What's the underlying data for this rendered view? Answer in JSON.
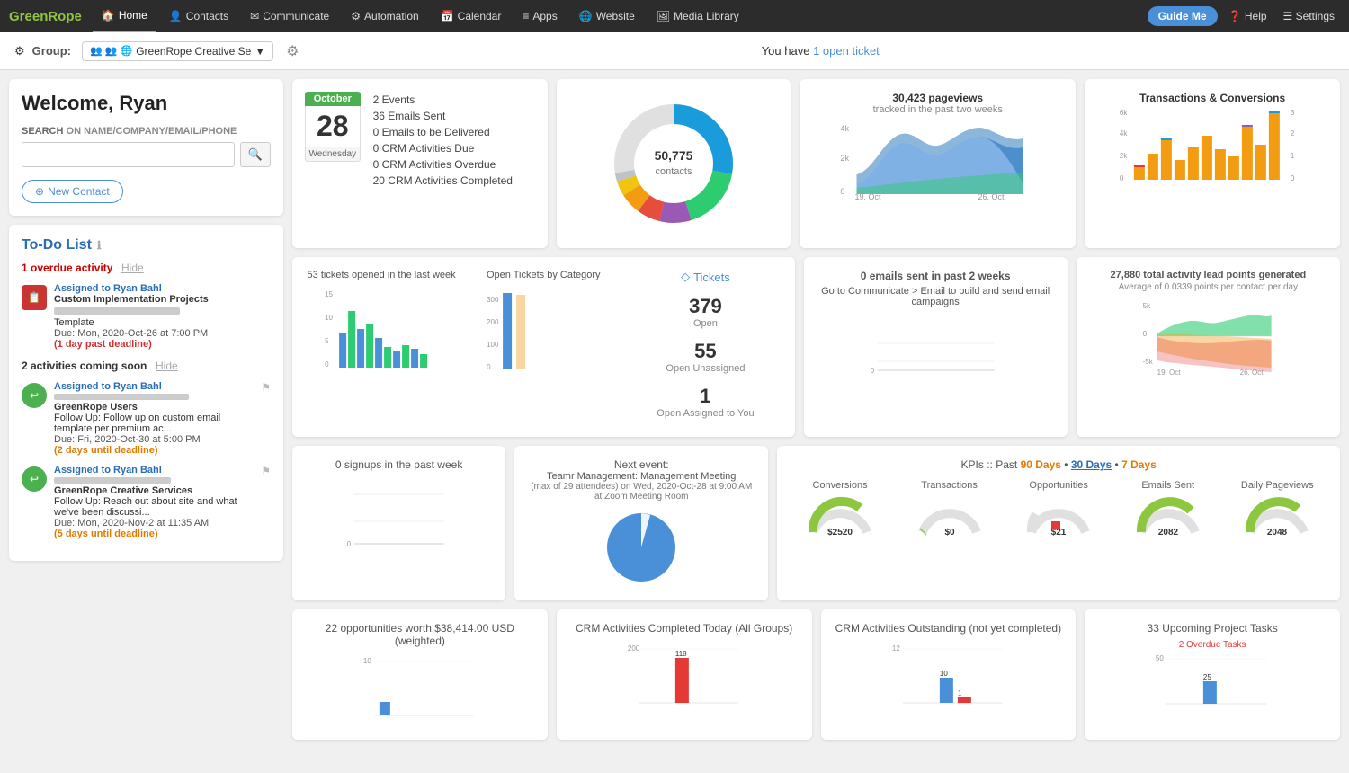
{
  "nav": {
    "logo_green": "GreenRope",
    "items": [
      {
        "label": "Home",
        "icon": "🏠",
        "active": true
      },
      {
        "label": "Contacts",
        "icon": "👤"
      },
      {
        "label": "Communicate",
        "icon": "✉"
      },
      {
        "label": "Automation",
        "icon": "⚙"
      },
      {
        "label": "Calendar",
        "icon": "📅"
      },
      {
        "label": "Apps",
        "icon": "≡"
      },
      {
        "label": "Website",
        "icon": "🌐"
      },
      {
        "label": "Media Library",
        "icon": "🖼"
      }
    ],
    "guide_me": "Guide Me",
    "help": "Help",
    "settings": "Settings"
  },
  "subbar": {
    "group_label": "Group:",
    "group_name": "GreenRope Creative Se",
    "open_ticket_text": "You have",
    "open_ticket_count": "1 open ticket"
  },
  "welcome": {
    "title": "Welcome, Ryan",
    "search_label": "SEARCH",
    "search_sublabel": "On Name/Company/Email/Phone",
    "new_contact": "New Contact"
  },
  "calendar_stats": {
    "month": "October",
    "day": "28",
    "weekday": "Wednesday",
    "stats": [
      {
        "label": "2 Events"
      },
      {
        "label": "36 Emails Sent"
      },
      {
        "label": "0 Emails to be Delivered"
      },
      {
        "label": "0 CRM Activities Due"
      },
      {
        "label": "0 CRM Activities Overdue"
      },
      {
        "label": "20 CRM Activities Completed"
      }
    ]
  },
  "contacts_donut": {
    "total": "50,775",
    "label": "contacts"
  },
  "pageviews": {
    "title": "30,423 pageviews",
    "subtitle": "tracked in the past two weeks",
    "x_labels": [
      "19. Oct",
      "26. Oct"
    ],
    "y_labels": [
      "4k",
      "2k",
      "0"
    ]
  },
  "transactions": {
    "title": "Transactions & Conversions",
    "y_left": [
      "6k",
      "4k",
      "2k",
      "0"
    ],
    "y_right": [
      "3",
      "2",
      "1",
      "0"
    ]
  },
  "tickets_row": {
    "bar_title": "53 tickets opened in the last week",
    "pie_title": "Open Tickets by Category",
    "tickets_label": "Tickets",
    "open": {
      "num": "379",
      "label": "Open"
    },
    "open_unassigned": {
      "num": "55",
      "label": "Open Unassigned"
    },
    "open_assigned": {
      "num": "1",
      "label": "Open Assigned to You"
    },
    "y_labels": [
      "15",
      "10",
      "5",
      "0"
    ],
    "y_labels_pie": [
      "300",
      "200",
      "100",
      "0"
    ]
  },
  "emails_sent": {
    "title": "0 emails sent in past 2 weeks",
    "notice": "Go to Communicate > Email to build and send email campaigns"
  },
  "activity_points": {
    "title": "27,880 total activity lead points generated",
    "subtitle": "Average of 0.0339 points per contact per day",
    "x_labels": [
      "19. Oct",
      "26. Oct"
    ],
    "neg_label": "-5k",
    "zero_label": "0",
    "pos_label": "5k"
  },
  "signups": {
    "title": "0 signups in the past week",
    "y_zero": "0"
  },
  "next_event": {
    "label": "Next event:",
    "title": "Teamr Management: Management Meeting",
    "details": "(max of 29 attendees) on Wed, 2020-Oct-28 at 9:00 AM at Zoom Meeting Room"
  },
  "kpis": {
    "header": "KPIs :: Past",
    "periods": [
      "90 Days",
      "30 Days",
      "7 Days"
    ],
    "active_period": "30 Days",
    "items": [
      {
        "label": "Conversions",
        "value": "$2520",
        "color": "#8dc63f",
        "pct": 70
      },
      {
        "label": "Transactions",
        "value": "$0",
        "color": "#8dc63f",
        "pct": 5
      },
      {
        "label": "Opportunities",
        "value": "$21",
        "color": "#e0e0e0",
        "pct": 15,
        "accent": "#e53935"
      },
      {
        "label": "Emails Sent",
        "value": "2082",
        "color": "#8dc63f",
        "pct": 80
      },
      {
        "label": "Daily Pageviews",
        "value": "2048",
        "color": "#8dc63f",
        "pct": 75
      }
    ]
  },
  "bottom": {
    "opportunities": {
      "title": "22 opportunities worth $38,414.00 USD (weighted)",
      "y_label": "10"
    },
    "crm_activities": {
      "title": "CRM Activities Completed Today (All Groups)",
      "y_label": "200",
      "bar_value": "118"
    },
    "crm_outstanding": {
      "title": "CRM Activities Outstanding (not yet completed)",
      "y_labels": [
        "12",
        "",
        ""
      ],
      "bar_value": "10"
    },
    "project_tasks": {
      "title": "33 Upcoming Project Tasks",
      "subtitle": "2 Overdue Tasks",
      "y_label": "50",
      "bar_value": "25"
    }
  },
  "todo": {
    "title": "To-Do List",
    "overdue_label": "1 overdue activity",
    "hide_label": "Hide",
    "overdue_item": {
      "assigned": "Assigned to Ryan Bahl",
      "project": "Custom Implementation Projects",
      "type": "Template",
      "due": "Due: Mon, 2020-Oct-26 at 7:00 PM",
      "status": "(1 day past deadline)"
    },
    "coming_soon_label": "2 activities coming soon",
    "coming_soon_hide": "Hide",
    "soon_items": [
      {
        "assigned": "Assigned to Ryan Bahl",
        "company": "GreenRope Users",
        "task": "Follow Up: Follow up on custom email template per premium ac...",
        "due": "Due: Fri, 2020-Oct-30 at 5:00 PM",
        "status": "(2 days until deadline)"
      },
      {
        "assigned": "Assigned to Ryan Bahl",
        "company": "GreenRope Creative Services",
        "task": "Follow Up: Reach out about site and what we've been discussi...",
        "due": "Due: Mon, 2020-Nov-2 at 11:35 AM",
        "status": "(5 days until deadline)"
      }
    ]
  }
}
